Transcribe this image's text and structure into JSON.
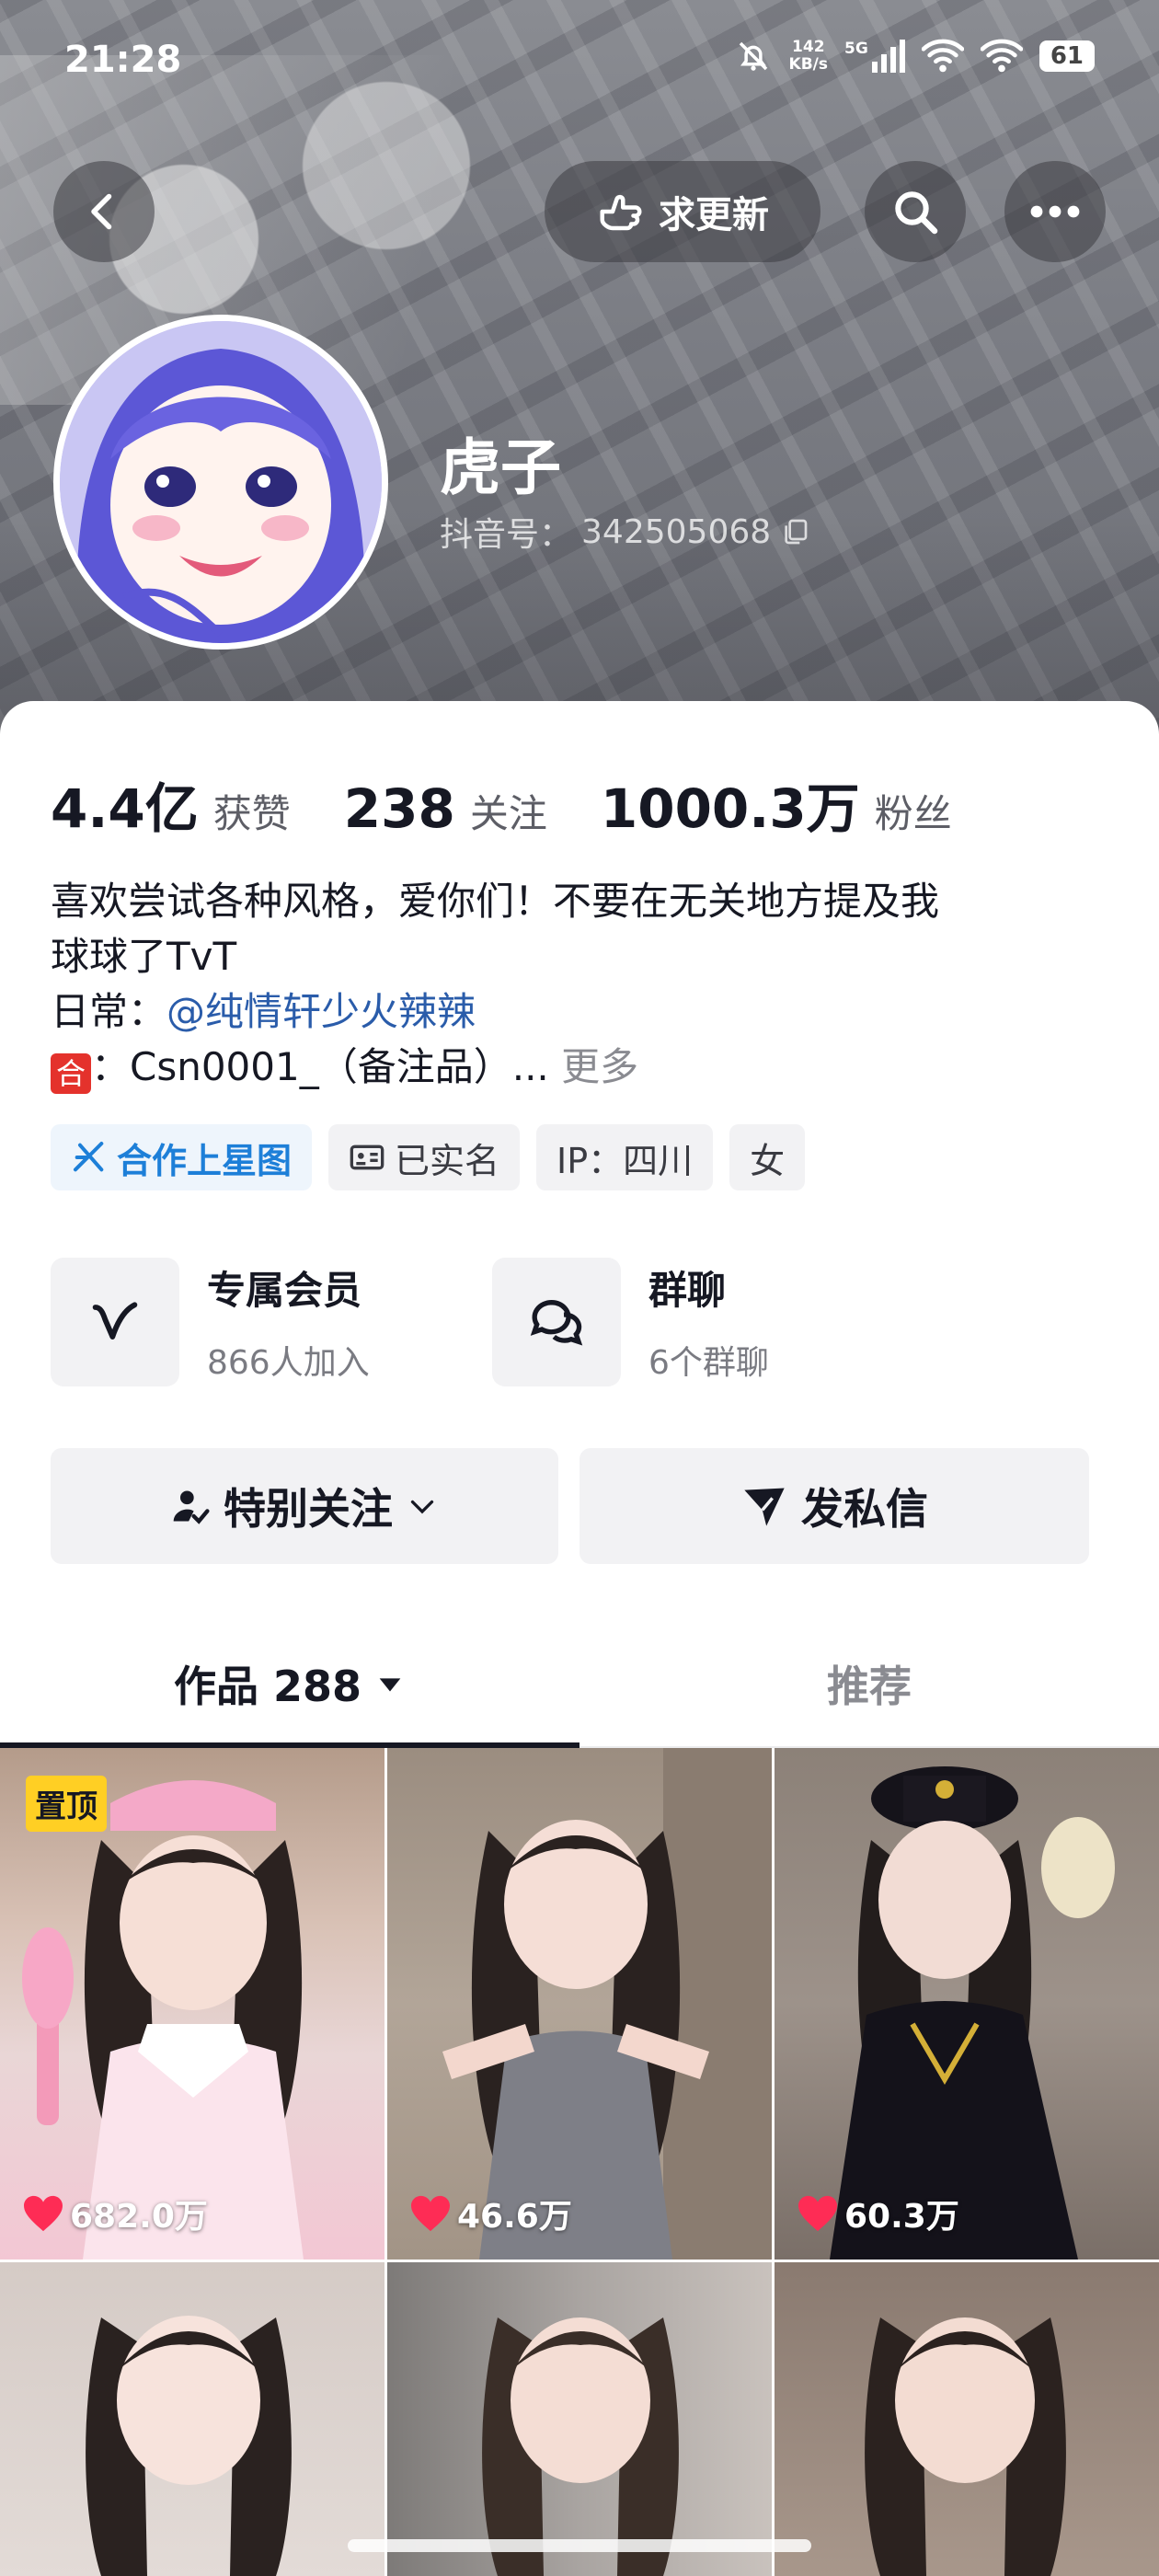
{
  "status_bar": {
    "time": "21:28",
    "net_speed_value": "142",
    "net_speed_unit": "KB/s",
    "signal_label": "5G",
    "battery": "61",
    "icons": [
      "mute-bell-icon",
      "signal-5g-icon",
      "wifi-icon",
      "wifi-icon",
      "battery-icon"
    ]
  },
  "header": {
    "request_update_label": "求更新",
    "icons": [
      "back-icon",
      "hand-point-icon",
      "search-icon",
      "more-icon"
    ]
  },
  "profile": {
    "nickname": "虎子",
    "douyin_id_label": "抖音号：",
    "douyin_id_value": "342505068",
    "copy_icon": "copy-icon"
  },
  "stats": [
    {
      "value": "4.4亿",
      "label": "获赞"
    },
    {
      "value": "238",
      "label": "关注"
    },
    {
      "value": "1000.3万",
      "label": "粉丝"
    }
  ],
  "bio": {
    "line1": "喜欢尝试各种风格，爱你们！不要在无关地方提及我",
    "line2": "球球了TvT",
    "line3_prefix": "日常：",
    "line3_mention": "@纯情轩少火辣辣",
    "line4_badge": "合",
    "line4_text": "：Csn0001_（备注品）...",
    "line4_more": "更多"
  },
  "tags": [
    {
      "label": "合作上星图",
      "icon": "star-map-icon"
    },
    {
      "label": "已实名",
      "icon": "id-card-icon"
    },
    {
      "label": "IP：四川"
    },
    {
      "label": "女"
    }
  ],
  "features": [
    {
      "title": "专属会员",
      "subtitle": "866人加入",
      "icon": "v-membership-icon"
    },
    {
      "title": "群聊",
      "subtitle": "6个群聊",
      "icon": "chat-bubbles-icon"
    }
  ],
  "actions": {
    "special_follow": "特别关注",
    "send_message": "发私信"
  },
  "tabs": {
    "works": "作品 288",
    "recommend": "推荐"
  },
  "videos": [
    {
      "pinned_label": "置顶",
      "likes": "682.0万"
    },
    {
      "likes": "46.6万"
    },
    {
      "likes": "60.3万"
    },
    {},
    {},
    {}
  ],
  "colors": {
    "like_heart": "#fe2c55",
    "mention": "#2a5caa",
    "star_tag": "#1d7fd8",
    "pin_badge": "#ffcf24"
  }
}
